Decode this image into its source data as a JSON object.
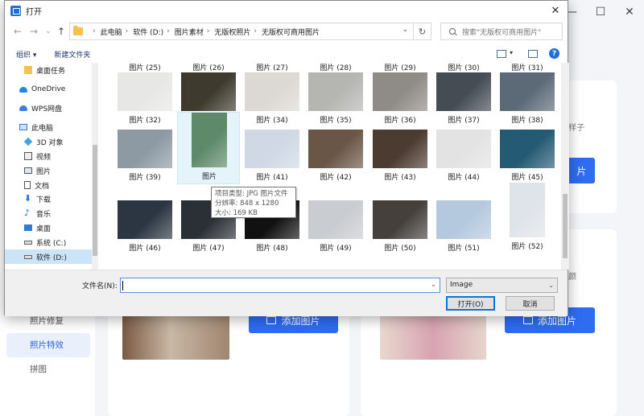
{
  "background_app": {
    "window_controls": [
      "—",
      "☐",
      "✕"
    ],
    "nav": [
      "照片修复",
      "照片特效",
      "拼图"
    ],
    "active_nav": "照片特效",
    "add_image_label": "添加图片",
    "partial_text": [
      "样子",
      "颜"
    ]
  },
  "dialog": {
    "title": "打开",
    "close": "✕",
    "address": {
      "crumbs": [
        "此电脑",
        "软件 (D:)",
        "图片素材",
        "无版权照片",
        "无版权可商用图片"
      ]
    },
    "search": {
      "placeholder": "搜索\"无版权可商用图片\""
    },
    "commands": {
      "organize": "组织 ▾",
      "new_folder": "新建文件夹"
    },
    "nav_items": [
      {
        "label": "桌面任务",
        "icon": "folder-icon"
      },
      {
        "label": "OneDrive",
        "icon": "cloud-icon"
      },
      {
        "label": "WPS网盘",
        "icon": "cloud-drive-icon"
      },
      {
        "label": "此电脑",
        "icon": "computer-icon"
      },
      {
        "label": "3D 对象",
        "icon": "3d-objects-icon"
      },
      {
        "label": "视频",
        "icon": "video-icon"
      },
      {
        "label": "图片",
        "icon": "picture-icon"
      },
      {
        "label": "文档",
        "icon": "document-icon"
      },
      {
        "label": "下载",
        "icon": "download-icon"
      },
      {
        "label": "音乐",
        "icon": "music-icon"
      },
      {
        "label": "桌面",
        "icon": "desktop-icon"
      },
      {
        "label": "系统 (C:)",
        "icon": "drive-icon"
      },
      {
        "label": "软件 (D:)",
        "icon": "drive-icon"
      }
    ],
    "selected_nav": "软件 (D:)",
    "files": [
      "图片 (25)",
      "图片 (26)",
      "图片 (27)",
      "图片 (28)",
      "图片 (29)",
      "图片 (30)",
      "图片 (31)",
      "图片 (32)",
      "图片 (33)",
      "图片 (34)",
      "图片 (35)",
      "图片 (36)",
      "图片 (37)",
      "图片 (38)",
      "图片 (39)",
      "图片",
      "图片 (41)",
      "图片 (42)",
      "图片 (43)",
      "图片 (44)",
      "图片 (45)",
      "图片 (46)",
      "图片 (47)",
      "图片 (48)",
      "图片 (49)",
      "图片 (50)",
      "图片 (51)",
      "图片 (52)"
    ],
    "thumb_colors": [
      "#6b6f74",
      "#58623f",
      "#cfcac4",
      "#9a9590",
      "#7d8c99",
      "#5d6670",
      "#66707b",
      "#e7e7e5",
      "#3e3a2d",
      "#dcd9d4",
      "#b5b5b2",
      "#8f8b86",
      "#454c54",
      "#5c6a78",
      "#8d9aa3",
      "#5f8a6a",
      "#cfd8e4",
      "#6a5646",
      "#4c3b30",
      "#e3e3e3",
      "#245a73",
      "#2c3642",
      "#2b3036",
      "#111111",
      "#c9ccd0",
      "#45403c",
      "#b5c9de",
      "#dfe4ea"
    ],
    "hovered_file": "图片",
    "tooltip": [
      "项目类型: JPG 图片文件",
      "分辨率: 848 x 1280",
      "大小: 169 KB"
    ],
    "filename_label": "文件名(N):",
    "filename_value": "",
    "filetype": "Image",
    "open_button": "打开(O)",
    "cancel_button": "取消"
  }
}
